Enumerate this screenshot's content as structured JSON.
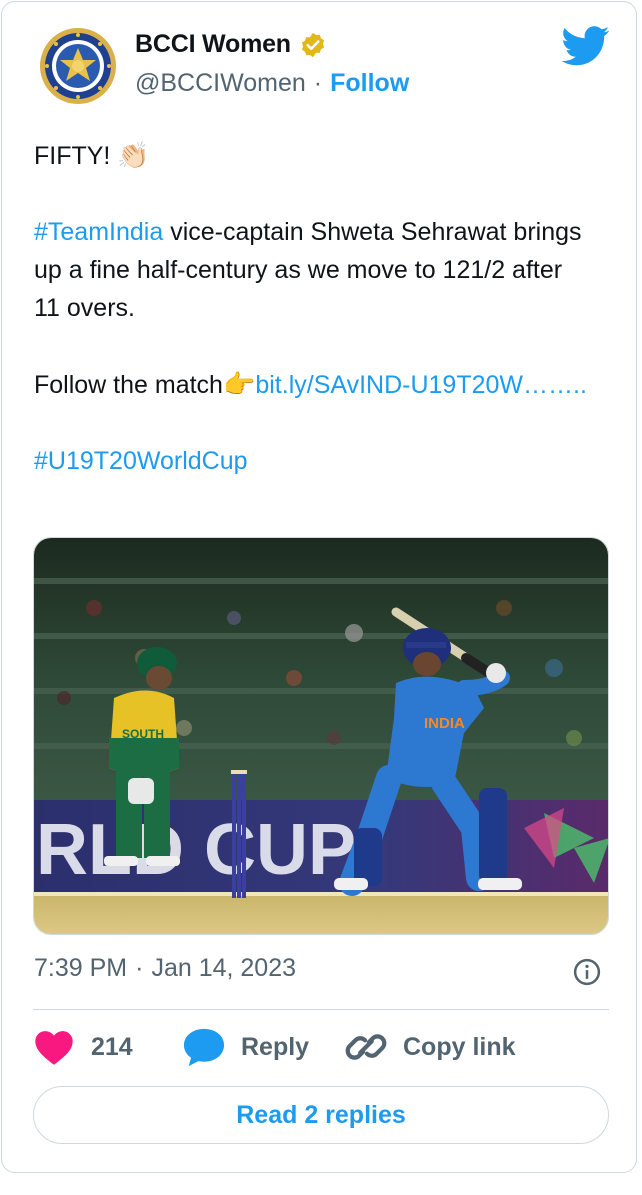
{
  "author": {
    "name": "BCCI Women",
    "handle": "@BCCIWomen",
    "separator": "·",
    "follow_label": "Follow",
    "verified_color": "#e2b719"
  },
  "tweet": {
    "line1": "FIFTY! ",
    "line1_emoji": "👏🏻",
    "hashtag_team": "#TeamIndia",
    "para2_rest": " vice-captain Shweta Sehrawat brings up a fine half-century as we move to 121/2 after 11 overs.",
    "follow_text": "Follow the match",
    "follow_emoji": "👉",
    "link_text": "bit.ly/SAvIND-U19T20W……..",
    "hashtag_cup": "#U19T20WorldCup"
  },
  "media": {
    "banner_text": "RLD CUP",
    "jersey_left": "SOUTH",
    "jersey_right": "INDIA"
  },
  "meta": {
    "time": "7:39 PM",
    "separator": "·",
    "date": "Jan 14, 2023"
  },
  "actions": {
    "like_count": "214",
    "reply_label": "Reply",
    "copy_label": "Copy link"
  },
  "read_replies_label": "Read 2 replies",
  "icons": {
    "twitter": "twitter-bird-icon",
    "verified": "verified-badge-icon",
    "info": "info-icon",
    "heart": "heart-icon",
    "reply": "speech-bubble-icon",
    "link": "link-icon"
  },
  "colors": {
    "accent": "#1d9bf0",
    "heart": "#f91880",
    "muted": "#536471",
    "border": "#cfd9de"
  }
}
